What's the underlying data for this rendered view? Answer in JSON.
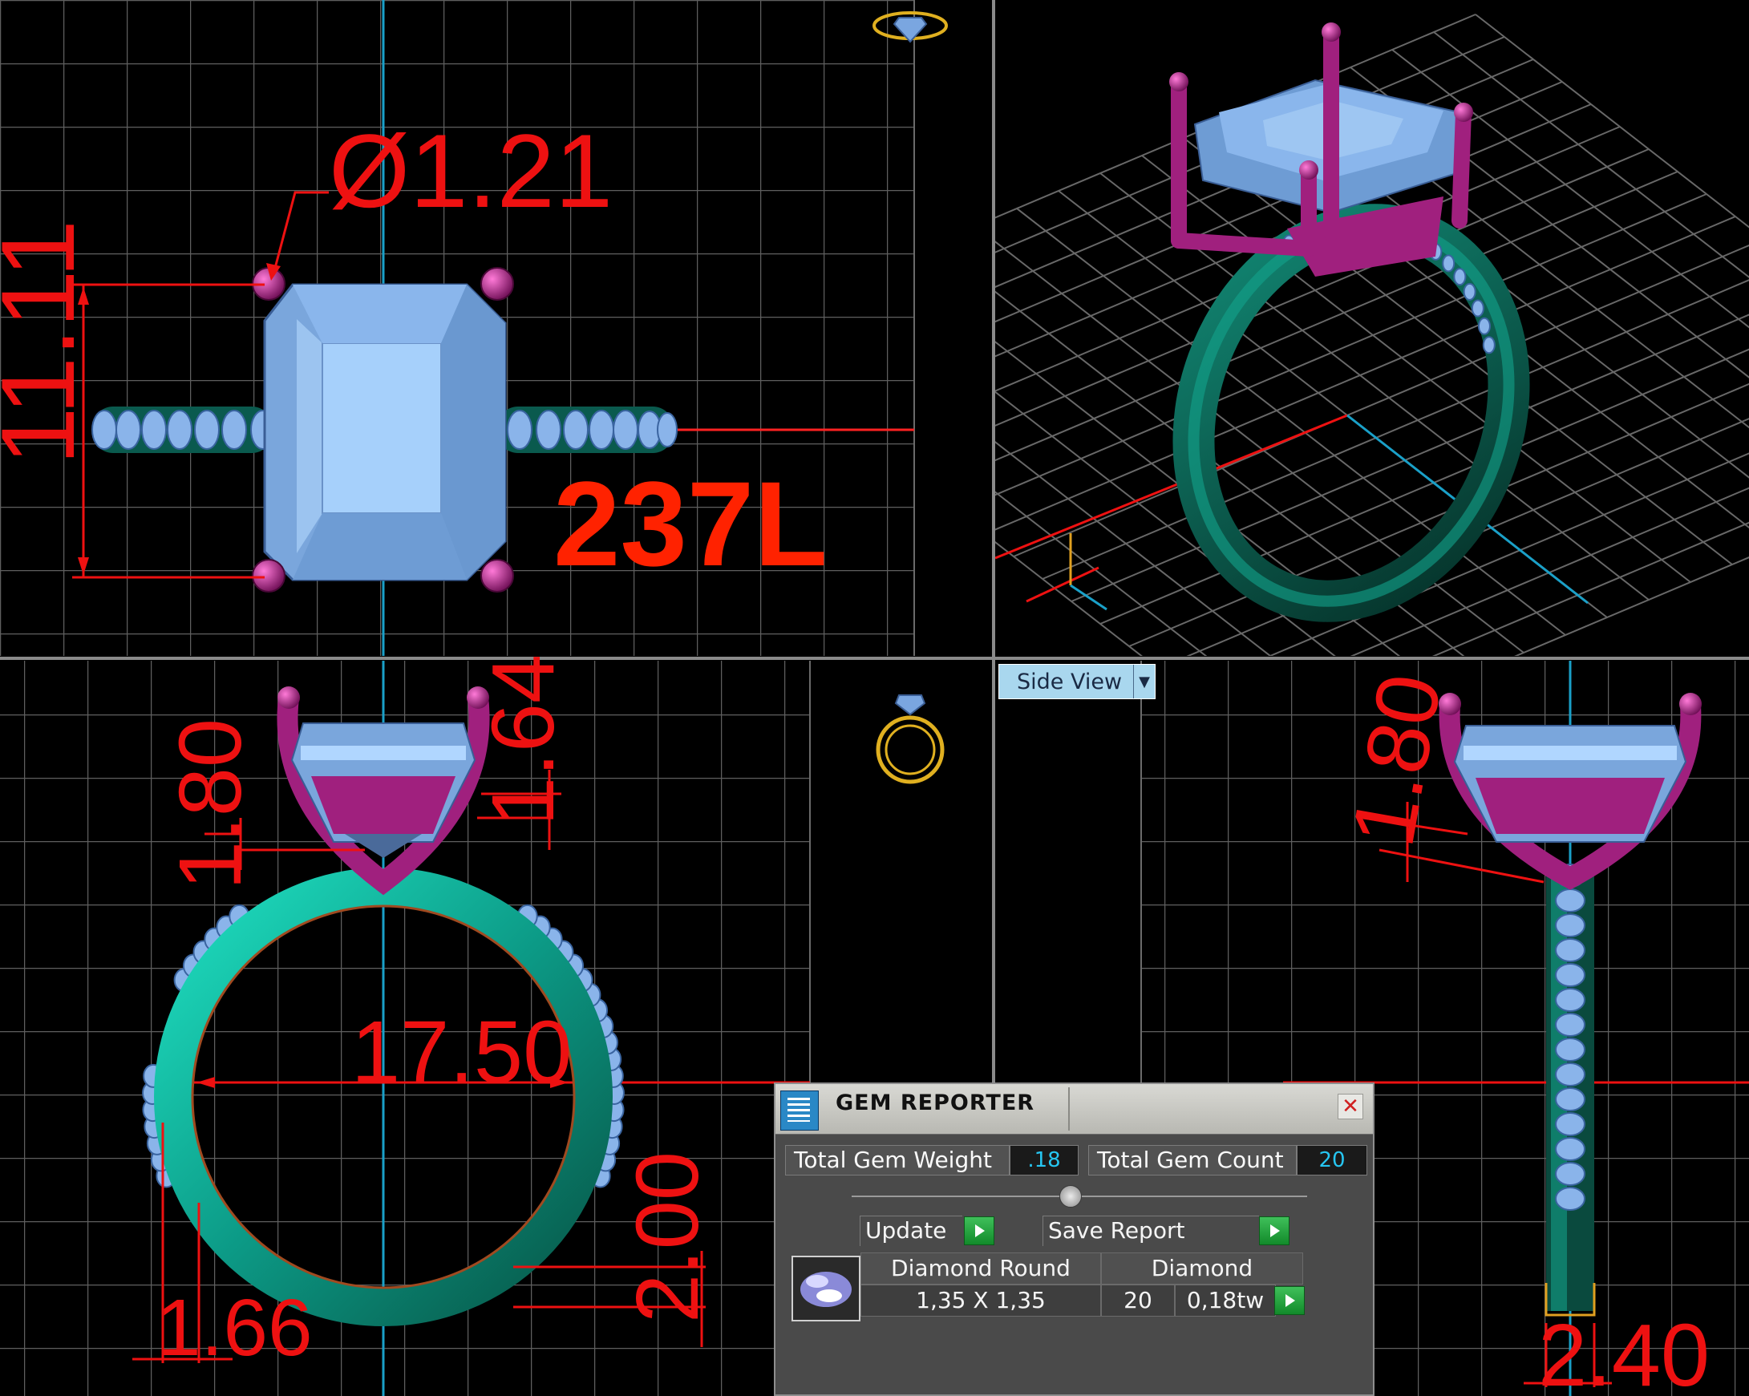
{
  "dimensions": {
    "prong_diameter": "Ø1.21",
    "stone_length": "11.11",
    "ring_size_label": "237L",
    "front_prong_height": "1.80",
    "front_depth": "1.64",
    "inner_diameter": "17.50",
    "shank_thickness": "2.00",
    "shank_width_bottom": "1.66",
    "side_prong_height": "1.80",
    "side_width_bottom": "2.40"
  },
  "views": {
    "side_view_selector": "Side View"
  },
  "gem_reporter": {
    "title": "GEM REPORTER",
    "total_weight_label": "Total Gem Weight",
    "total_weight_value": ".18",
    "total_count_label": "Total Gem Count",
    "total_count_value": "20",
    "update_label": "Update",
    "save_label": "Save Report",
    "gems": [
      {
        "name": "Diamond Round",
        "size": "1,35 X 1,35",
        "material": "Diamond",
        "count": "20",
        "weight": "0,18tw"
      }
    ]
  },
  "colors": {
    "metal_band": "#0e7a6a",
    "prongs": "#a0207e",
    "stone": "#8ab4e8",
    "dimension_lines": "#ee1111",
    "grid": "#5a5a5a",
    "axis_blue": "#1aa0c8"
  },
  "icons": [
    "view-cube-top-icon",
    "view-cube-front-icon",
    "gem-reporter-icon",
    "close-icon",
    "play-arrow-icon",
    "dropdown-arrow-icon"
  ]
}
